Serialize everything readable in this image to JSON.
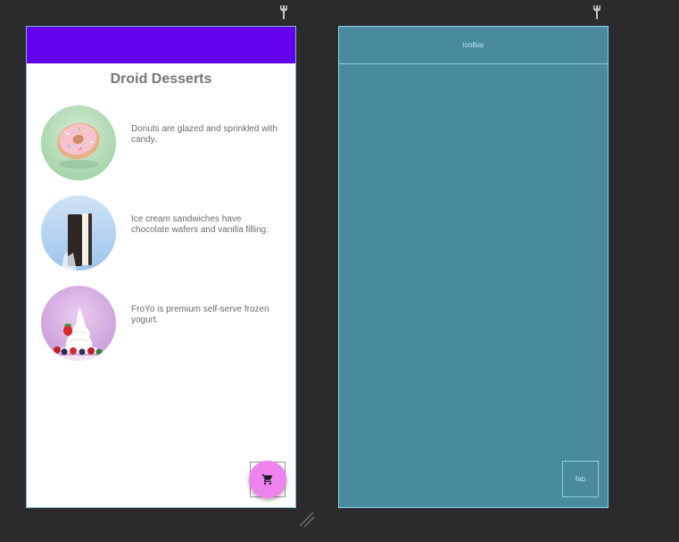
{
  "icons": {
    "layout_tool_left": "wrench-icon",
    "layout_tool_right": "wrench-icon",
    "fab": "shopping-cart-icon",
    "resize": "resize-handle-icon"
  },
  "colors": {
    "canvas_background": "#2b2b2d",
    "app_bar": "#6200ee",
    "fab": "#ee82ee",
    "blueprint_fill": "#4a8a9e",
    "blueprint_line": "#8fd0e3"
  },
  "design": {
    "screen_title": "Droid Desserts",
    "desserts": [
      {
        "name": "Donut",
        "image": "donut-image",
        "description": "Donuts are glazed and sprinkled with candy."
      },
      {
        "name": "Ice cream sandwich",
        "image": "ice-cream-sandwich-image",
        "description": "Ice cream sandwiches have chocolate wafers and vanilla filling."
      },
      {
        "name": "FroYo",
        "image": "froyo-image",
        "description": "FroYo is premium self-serve frozen yogurt."
      }
    ]
  },
  "blueprint": {
    "toolbar_label": "toolbar",
    "fab_label": "fab"
  }
}
